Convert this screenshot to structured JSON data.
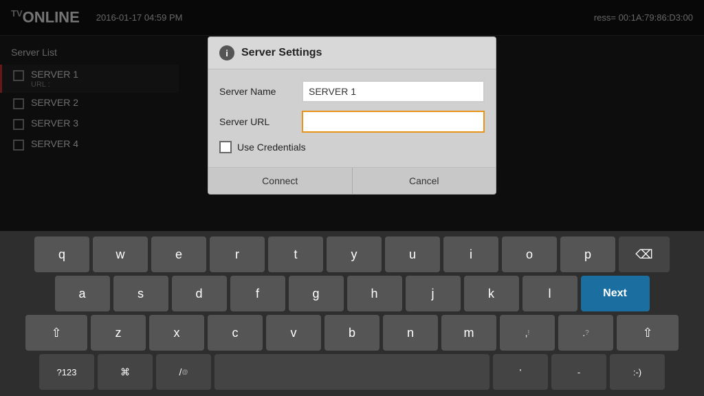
{
  "header": {
    "logo_tv": "TV",
    "logo_online": "ONLINE",
    "datetime": "2016-01-17 04:59 PM",
    "mac_label": "ress= 00:1A:79:86:D3:00"
  },
  "server_list": {
    "title": "Server List",
    "servers": [
      {
        "name": "SERVER 1",
        "url": "URL :",
        "selected": true
      },
      {
        "name": "SERVER 2",
        "url": "",
        "selected": false
      },
      {
        "name": "SERVER 3",
        "url": "",
        "selected": false
      },
      {
        "name": "SERVER 4",
        "url": "",
        "selected": false
      }
    ]
  },
  "dialog": {
    "info_icon": "i",
    "title": "Server Settings",
    "server_name_label": "Server Name",
    "server_name_value": "SERVER 1",
    "server_url_label": "Server URL",
    "server_url_value": "",
    "credentials_label": "Use Credentials",
    "connect_btn": "Connect",
    "cancel_btn": "Cancel"
  },
  "keyboard": {
    "rows": [
      [
        "q",
        "w",
        "e",
        "r",
        "t",
        "y",
        "u",
        "i",
        "o",
        "p"
      ],
      [
        "a",
        "s",
        "d",
        "f",
        "g",
        "h",
        "j",
        "k",
        "l"
      ],
      [
        "z",
        "x",
        "c",
        "v",
        "b",
        "n",
        "m",
        ",",
        "."
      ],
      [
        "?123",
        "⌘",
        "/",
        "",
        "'",
        "-",
        ":-"
      ]
    ],
    "next_label": "Next",
    "backspace_label": "⌫",
    "shift_label": "⇧"
  }
}
